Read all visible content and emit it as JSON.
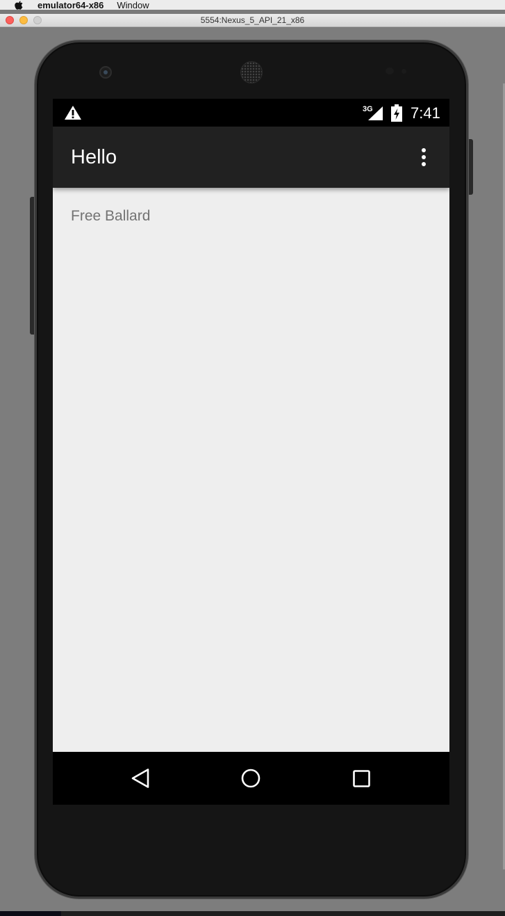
{
  "mac_menubar": {
    "app_name": "emulator64-x86",
    "menu_items": [
      "Window"
    ]
  },
  "window": {
    "title": "5554:Nexus_5_API_21_x86"
  },
  "status_bar": {
    "warning_icon": "warning-triangle-icon",
    "network_label": "3G",
    "signal_icon": "cell-signal-icon",
    "battery_icon": "battery-charging-icon",
    "time": "7:41"
  },
  "app_bar": {
    "title": "Hello",
    "overflow_icon": "more-vert-icon"
  },
  "content": {
    "text": "Free Ballard"
  },
  "nav_bar": {
    "back_icon": "back-triangle-icon",
    "home_icon": "home-circle-icon",
    "recents_icon": "recents-square-icon"
  },
  "colors": {
    "app_bar": "#212121",
    "screen_background": "#eeeeee",
    "status_bar": "#000000",
    "content_text": "#737373"
  }
}
